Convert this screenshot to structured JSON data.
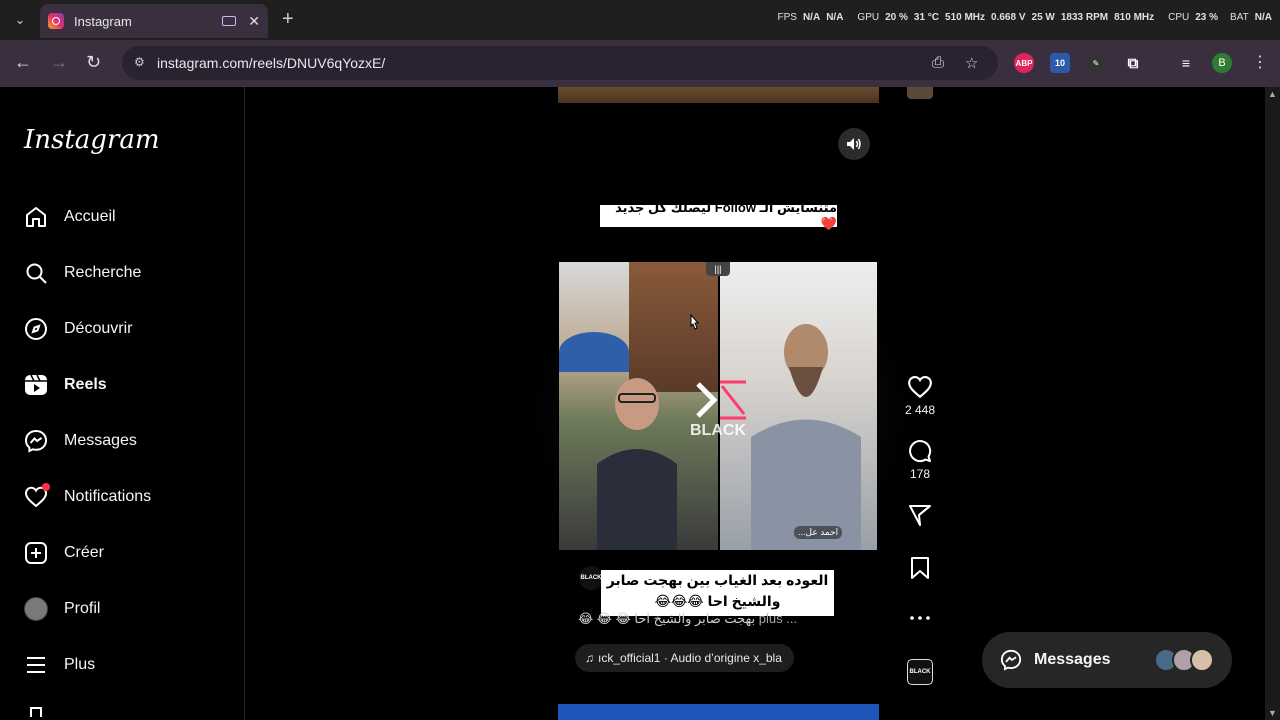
{
  "browser": {
    "tab_title": "Instagram",
    "new_tab_symbol": "+",
    "url": "instagram.com/reels/DNUV6qYozxE/",
    "hud": {
      "fps_label": "FPS",
      "fps_value": "N/A",
      "fps_value2": "N/A",
      "gpu_label": "GPU",
      "gpu_load": "20 %",
      "gpu_temp": "31 °C",
      "gpu_clock": "510 MHz",
      "gpu_volt": "0.668 V",
      "gpu_power": "25 W",
      "gpu_rpm": "1833 RPM",
      "gpu_mem": "810 MHz",
      "cpu_label": "CPU",
      "cpu_load": "23 %",
      "bat_label": "BAT",
      "bat_value": "N/A"
    },
    "extensions": {
      "abp": "ABP",
      "counter_badge": "10"
    },
    "profile_initial": "B"
  },
  "sidebar": {
    "logo": "Instagram",
    "items": [
      {
        "label": "Accueil",
        "icon": "home-icon"
      },
      {
        "label": "Recherche",
        "icon": "search-icon"
      },
      {
        "label": "Découvrir",
        "icon": "compass-icon"
      },
      {
        "label": "Reels",
        "icon": "reels-icon",
        "active": true
      },
      {
        "label": "Messages",
        "icon": "messenger-icon"
      },
      {
        "label": "Notifications",
        "icon": "heart-icon"
      },
      {
        "label": "Créer",
        "icon": "plus-square-icon"
      },
      {
        "label": "Profil",
        "icon": "profile-avatar"
      },
      {
        "label": "Plus",
        "icon": "hamburger-icon"
      }
    ]
  },
  "reel": {
    "top_caption": "متنسايش الـ Follow ليصلك كل جديد ❤️",
    "watermark": "BLACK",
    "creator_tag": "احمد عل...",
    "bottom_caption_line1": "العوده بعد الغياب بين بهجت صابر",
    "bottom_caption_line2": "والشيخ احا 😂😂😂",
    "description": "بهجت صابر والشيخ احا 😂 😂 😂",
    "more_label": "... plus",
    "audio": "ıck_official1 · Audio d’origine   x_bla"
  },
  "actions": {
    "likes": "2 448",
    "comments": "178"
  },
  "messages_bar": {
    "label": "Messages"
  },
  "colors": {
    "accent_notif": "#ff3040",
    "tab_bg": "#3a2f3f",
    "page_bg": "#000000"
  }
}
